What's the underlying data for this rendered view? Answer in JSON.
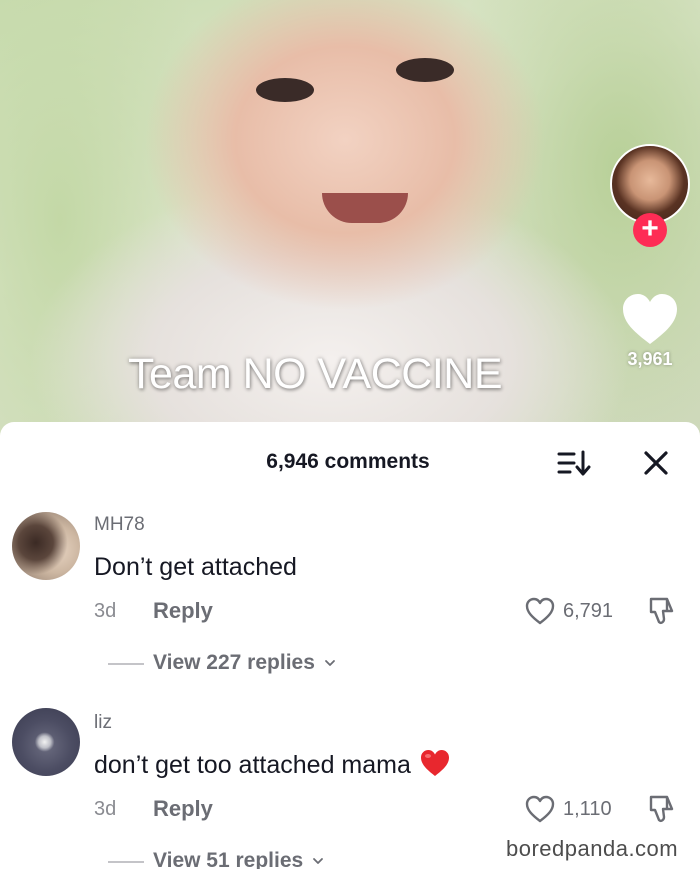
{
  "video": {
    "overlay_text": "Team NO VACCINE",
    "like_count": "3,961",
    "follow_icon": "plus-icon"
  },
  "comments_sheet": {
    "title": "6,946 comments",
    "sort_icon": "sort-icon",
    "close_icon": "close-icon"
  },
  "comments": [
    {
      "username": "MH78",
      "text": "Don’t get attached",
      "age": "3d",
      "reply_label": "Reply",
      "likes": "6,791",
      "view_replies": "View 227 replies"
    },
    {
      "username": "liz",
      "text": "don’t get too attached mama",
      "emoji": "red-heart",
      "age": "3d",
      "reply_label": "Reply",
      "likes": "1,110",
      "view_replies": "View 51 replies"
    }
  ],
  "watermark": "boredpanda.com",
  "colors": {
    "accent": "#fe2c55",
    "heart_emoji": "#e8272e",
    "text_primary": "#161823",
    "text_secondary": "#6b6d74"
  }
}
